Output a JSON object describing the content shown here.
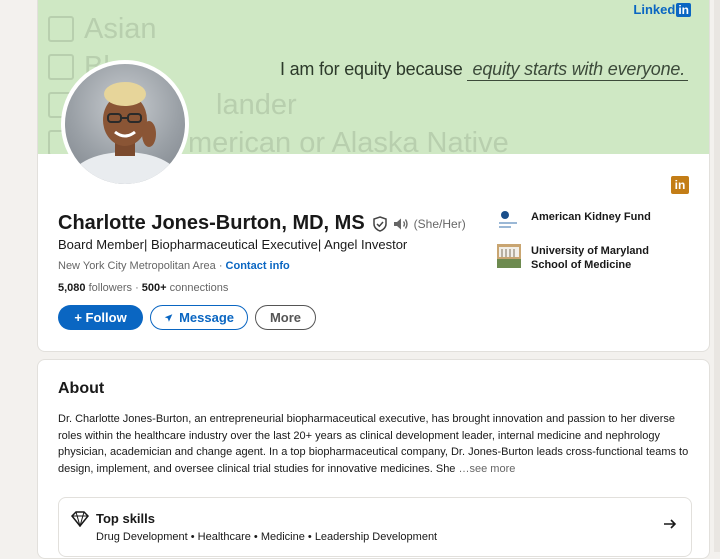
{
  "banner": {
    "ghost_lines": [
      "Asian",
      "Bl",
      "lander",
      "merican or Alaska Native"
    ],
    "tagline_prefix": "I am for equity because",
    "tagline_fill": "equity starts with everyone.",
    "brand_text": "Linked",
    "brand_in": "in"
  },
  "profile": {
    "name": "Charlotte Jones-Burton, MD, MS",
    "pronouns": "(She/Her)",
    "headline": "Board Member| Biopharmaceutical Executive| Angel Investor",
    "location": "New York City Metropolitan Area",
    "separator": "·",
    "contact_label": "Contact info",
    "followers_count": "5,080",
    "followers_label": "followers",
    "connections_count": "500+",
    "connections_label": "connections",
    "stats_separator": "·",
    "badge_icon": "in"
  },
  "actions": {
    "follow": "+ Follow",
    "message": "Message",
    "more": "More"
  },
  "orgs": [
    {
      "name": "American Kidney Fund"
    },
    {
      "name": "University of Maryland School of Medicine"
    }
  ],
  "about": {
    "title": "About",
    "text": "Dr. Charlotte Jones-Burton, an entrepreneurial biopharmaceutical executive, has brought innovation and passion to her diverse roles within the healthcare industry over the last 20+ years as clinical development leader, internal medicine and nephrology physician, academician and change agent. In a top biopharmaceutical company, Dr. Jones-Burton leads cross-functional teams to design, implement, and oversee clinical trial studies for innovative medicines. She",
    "see_more": "…see more"
  },
  "skills": {
    "title": "Top skills",
    "list": "Drug Development • Healthcare • Medicine • Leadership Development"
  },
  "colors": {
    "primary": "#0a66c2",
    "banner": "#cfe8c4",
    "badge": "#c37d16"
  }
}
